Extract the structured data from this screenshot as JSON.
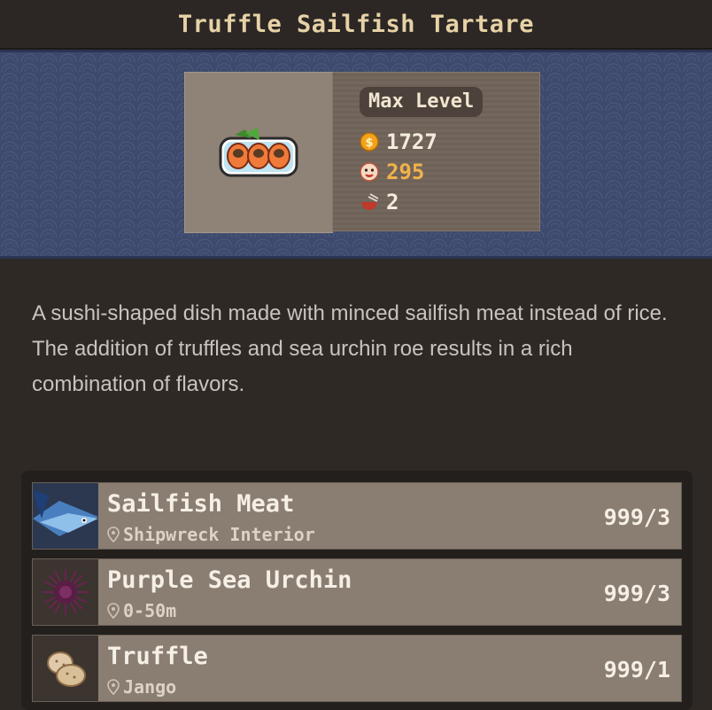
{
  "title": "Truffle Sailfish Tartare",
  "dish": {
    "image_icon": "sushi-dish-icon",
    "level_badge": "Max Level",
    "stats": {
      "price": "1727",
      "taste": "295",
      "servings": "2"
    },
    "colors": {
      "price": "#f3ebdc",
      "taste": "#f0b24a",
      "servings": "#f3ebdc"
    }
  },
  "description": [
    "A sushi-shaped dish made with minced sailfish meat instead of rice.",
    "The addition of truffles and sea urchin roe results in a rich combination of flavors."
  ],
  "ingredients": [
    {
      "name": "Sailfish Meat",
      "location": "Shipwreck Interior",
      "count": "999/3",
      "icon": "sailfish-icon"
    },
    {
      "name": "Purple Sea Urchin",
      "location": "0-50m",
      "count": "999/3",
      "icon": "sea-urchin-icon"
    },
    {
      "name": "Truffle",
      "location": "Jango",
      "count": "999/1",
      "icon": "truffle-icon"
    }
  ]
}
